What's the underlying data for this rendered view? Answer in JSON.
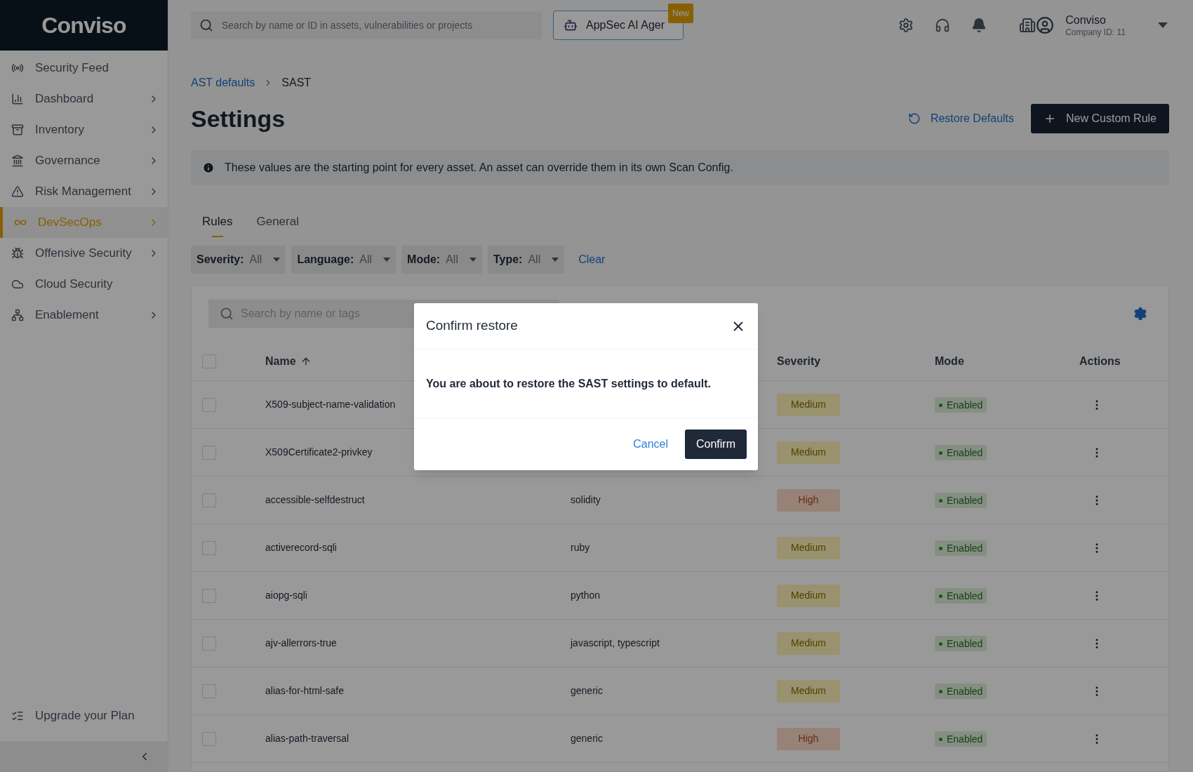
{
  "sidebar": {
    "logo": "Conviso",
    "items": [
      {
        "label": "Security Feed",
        "expandable": false,
        "selected": false
      },
      {
        "label": "Dashboard",
        "expandable": true,
        "selected": false
      },
      {
        "label": "Inventory",
        "expandable": true,
        "selected": false
      },
      {
        "label": "Governance",
        "expandable": true,
        "selected": false
      },
      {
        "label": "Risk Management",
        "expandable": true,
        "selected": false
      },
      {
        "label": "DevSecOps",
        "expandable": true,
        "selected": true
      },
      {
        "label": "Offensive Security",
        "expandable": true,
        "selected": false
      },
      {
        "label": "Cloud Security",
        "expandable": false,
        "selected": false
      },
      {
        "label": "Enablement",
        "expandable": true,
        "selected": false
      }
    ],
    "footer_item": "Upgrade your Plan"
  },
  "topbar": {
    "search_placeholder": "Search by name or ID in assets, vulnerabilities or projects",
    "agent_button": "AppSec AI Ager",
    "badge": "New",
    "user": {
      "name": "Conviso",
      "company": "Company ID: 11"
    }
  },
  "breadcrumb": [
    "AST defaults",
    "SAST"
  ],
  "title": "Settings",
  "actions": {
    "restore": "Restore Defaults",
    "new_rule": "New Custom Rule"
  },
  "info": "These values are the starting point for every asset. An asset can override them in its own Scan Config.",
  "tabs": [
    {
      "label": "Rules",
      "selected": true
    },
    {
      "label": "General",
      "selected": false
    }
  ],
  "filters": [
    {
      "label": "Severity:",
      "value": "All"
    },
    {
      "label": "Language:",
      "value": "All"
    },
    {
      "label": "Mode:",
      "value": "All"
    },
    {
      "label": "Type:",
      "value": "All"
    }
  ],
  "clear": "Clear",
  "table": {
    "search_placeholder": "Search by name or tags",
    "all_checked": false,
    "columns": {
      "name": "Name",
      "severity": "Severity",
      "mode": "Mode",
      "actions": "Actions"
    },
    "rows": [
      {
        "checked": false,
        "name": "X509-subject-name-validation",
        "severity": {
          "label": "Medium",
          "kind": "medium"
        },
        "mode": {
          "label": "Enabled",
          "kind": "enabled"
        }
      },
      {
        "checked": false,
        "name": "X509Certificate2-privkey",
        "severity": {
          "label": "Medium",
          "kind": "medium"
        },
        "mode": {
          "label": "Enabled",
          "kind": "enabled"
        }
      },
      {
        "checked": false,
        "name": "accessible-selfdestruct",
        "language": "solidity",
        "severity": {
          "label": "High",
          "kind": "high"
        },
        "mode": {
          "label": "Enabled",
          "kind": "enabled"
        }
      },
      {
        "checked": false,
        "name": "activerecord-sqli",
        "language": "ruby",
        "severity": {
          "label": "Medium",
          "kind": "medium"
        },
        "mode": {
          "label": "Enabled",
          "kind": "enabled"
        }
      },
      {
        "checked": false,
        "name": "aiopg-sqli",
        "language": "python",
        "severity": {
          "label": "Medium",
          "kind": "medium"
        },
        "mode": {
          "label": "Enabled",
          "kind": "enabled"
        }
      },
      {
        "checked": false,
        "name": "ajv-allerrors-true",
        "language": "javascript, typescript",
        "severity": {
          "label": "Medium",
          "kind": "medium"
        },
        "mode": {
          "label": "Enabled",
          "kind": "enabled"
        }
      },
      {
        "checked": false,
        "name": "alias-for-html-safe",
        "language": "generic",
        "severity": {
          "label": "Medium",
          "kind": "medium"
        },
        "mode": {
          "label": "Enabled",
          "kind": "enabled"
        }
      },
      {
        "checked": false,
        "name": "alias-path-traversal",
        "language": "generic",
        "severity": {
          "label": "High",
          "kind": "high"
        },
        "mode": {
          "label": "Enabled",
          "kind": "enabled"
        }
      }
    ]
  },
  "dialog": {
    "title": "Confirm restore",
    "message": "You are about to restore the SAST settings to default.",
    "cancel": "Cancel",
    "confirm": "Confirm"
  }
}
